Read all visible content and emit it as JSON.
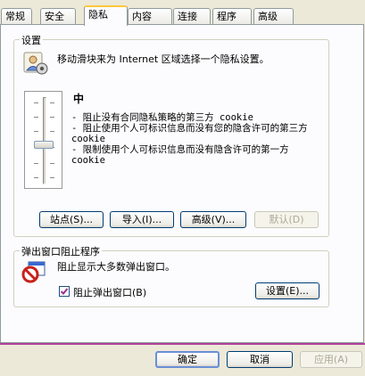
{
  "tabs": [
    {
      "label": "常规"
    },
    {
      "label": "安全"
    },
    {
      "label": "隐私"
    },
    {
      "label": "内容"
    },
    {
      "label": "连接"
    },
    {
      "label": "程序"
    },
    {
      "label": "高级"
    }
  ],
  "active_tab": "隐私",
  "settings": {
    "title": "设置",
    "instruction": "移动滑块来为 Internet 区域选择一个隐私设置。",
    "level": "中",
    "desc_line1": "- 阻止没有合同隐私策略的第三方 cookie",
    "desc_line2": "- 阻止使用个人可标识信息而没有您的隐含许可的第三方 cookie",
    "desc_line3": "- 限制使用个人可标识信息而没有隐含许可的第一方 cookie",
    "slider_position": "3 of 6 (中)",
    "buttons": {
      "sites": "站点(S)...",
      "import": "导入(I)...",
      "advanced": "高级(V)...",
      "default": "默认(D)"
    }
  },
  "popup": {
    "title": "弹出窗口阻止程序",
    "description": "阻止显示大多数弹出窗口。",
    "checkbox_label": "阻止弹出窗口(B)",
    "checkbox_checked": true,
    "settings_button": "设置(E)..."
  },
  "footer": {
    "ok": "确定",
    "cancel": "取消",
    "apply": "应用(A)"
  },
  "colors": {
    "accent": "#ffc83c",
    "button_border": "#003c74",
    "footer_divider": "#b0429c",
    "checkbox_check": "#9d2f8e"
  }
}
